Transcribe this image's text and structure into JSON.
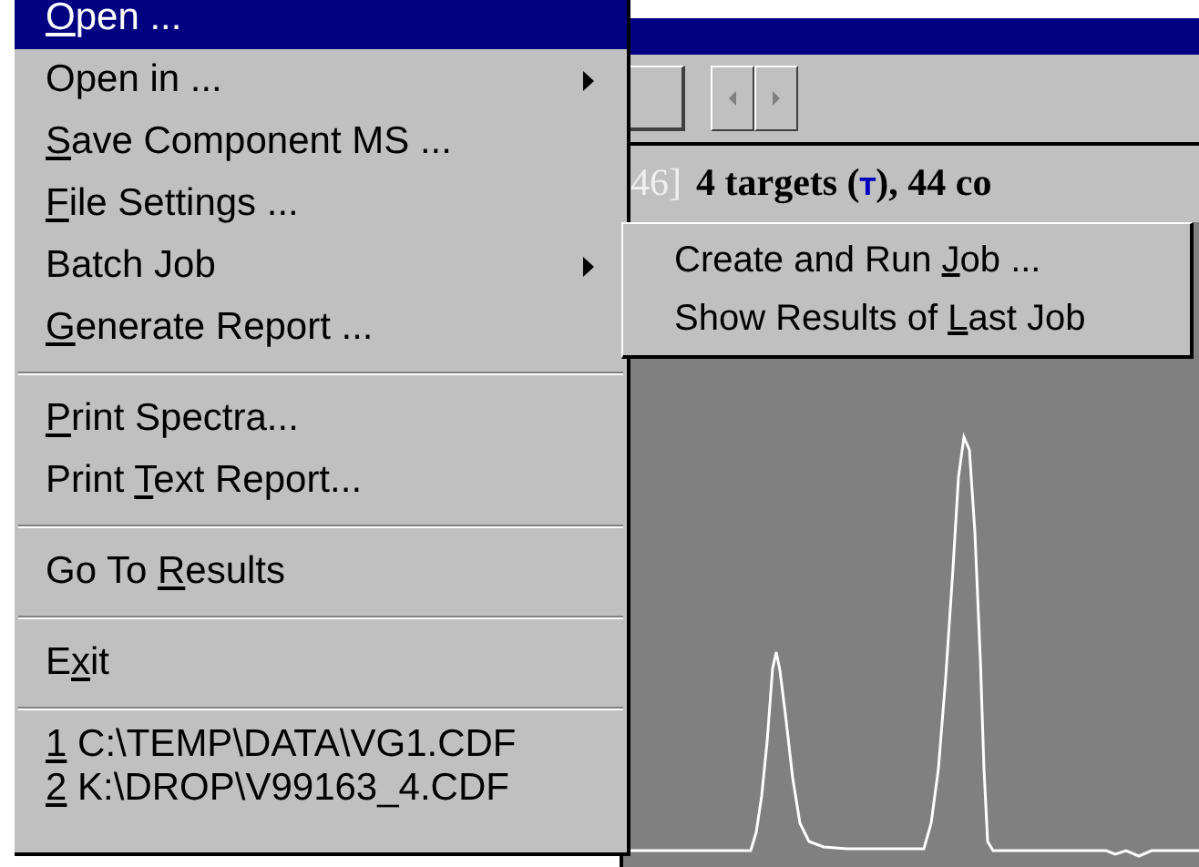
{
  "menu": {
    "items": [
      {
        "kind": "item",
        "access_key": "O",
        "label_end": "pen ...",
        "selected": true,
        "submenu": false
      },
      {
        "kind": "item",
        "label_end": "Open in ...",
        "selected": false,
        "submenu": true
      },
      {
        "kind": "item",
        "access_key": "S",
        "label_end": "ave Component MS ...",
        "selected": false,
        "submenu": false
      },
      {
        "kind": "item",
        "access_key": "F",
        "label_end": "ile Settings ...",
        "selected": false,
        "submenu": false
      },
      {
        "kind": "item",
        "label_end": "Batch Job",
        "selected": false,
        "submenu": true
      },
      {
        "kind": "item",
        "access_key": "G",
        "label_end": "enerate Report ...",
        "selected": false,
        "submenu": false
      },
      {
        "kind": "separator"
      },
      {
        "kind": "item",
        "access_key": "P",
        "label_end": "rint Spectra...",
        "selected": false,
        "submenu": false
      },
      {
        "kind": "item",
        "label_start": "Print ",
        "access_key": "T",
        "label_end": "ext Report...",
        "selected": false,
        "submenu": false
      },
      {
        "kind": "separator"
      },
      {
        "kind": "item",
        "label_start": "Go To ",
        "access_key": "R",
        "label_end": "esults",
        "selected": false,
        "submenu": false
      },
      {
        "kind": "separator"
      },
      {
        "kind": "item",
        "label_start": "E",
        "access_key": "x",
        "label_end": "it",
        "selected": false,
        "submenu": false
      },
      {
        "kind": "separator"
      },
      {
        "kind": "recent",
        "access_key": "1",
        "label_end": " C:\\TEMP\\DATA\\VG1.CDF",
        "selected": false,
        "submenu": false
      },
      {
        "kind": "recent",
        "access_key": "2",
        "label_end": " K:\\DROP\\V99163_4.CDF",
        "selected": false,
        "submenu": false
      }
    ]
  },
  "submenu": {
    "items": [
      {
        "label_start": "Create and Run ",
        "access_key": "J",
        "label_end": "ob ..."
      },
      {
        "label_start": "Show Results of ",
        "access_key": "L",
        "label_end": "ast Job"
      }
    ]
  },
  "header": {
    "range_end": "46]",
    "summary_start": "4 targets (",
    "target_mark": "T",
    "summary_end": "), 44 co"
  }
}
